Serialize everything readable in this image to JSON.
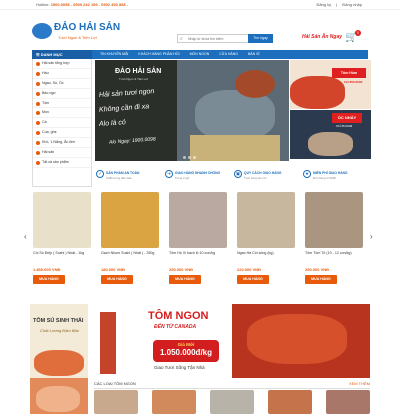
{
  "topbar": {
    "hotline_label": "Hotline:",
    "hotline_numbers": "1900.0098 - 0909 242 199 - 0902 450 868 -",
    "register": "Đăng ký",
    "divider": "|",
    "login": "Đăng nhập"
  },
  "header": {
    "logo_title": "ĐẢO HẢI SẢN",
    "logo_sub": "Tươi Ngon & Tiện Lợi",
    "search_placeholder": "Nhập từ khóa tìm kiếm",
    "search_button": "Tìm ngay",
    "slogan": "Hải Sản Ăn Ngay",
    "cart_count": "0"
  },
  "nav": {
    "category_label": "DANH MỤC",
    "links": [
      "TIN KHUYẾN MÃI",
      "KHÁCH HÀNG PHẢN HỒI",
      "MÓN NGON",
      "CỬA HÀNG",
      "BÁN SỈ"
    ]
  },
  "sidebar": {
    "items": [
      "Hải sản tổng hợp",
      "Hàu",
      "Ngao, Sò, Ốc",
      "Bào ngư",
      "Tôm",
      "Mực",
      "Cá",
      "Cua, ghẹ",
      "Khô, 1 Nắng, Ăn liền",
      "Hải sản",
      "Tất cả sản phẩm"
    ]
  },
  "banner": {
    "logo": "ĐẢO HẢI SẢN",
    "logo_sub": "Tươi Ngon & Tiện Lợi",
    "line1": "Hải sản tươi ngon",
    "line2": "Không cần đi xa",
    "line3": "Alo là có",
    "hotline": "Alo Ngay: 1900.0098"
  },
  "side_ads": {
    "ad1_tag": "Tôm Hùm",
    "ad1_price": "Chỉ 850.000đ",
    "ad2_tag": "ỐC NHẢY",
    "ad2_price": "Chỉ 45.000đ"
  },
  "features": [
    {
      "title": "SẢN PHẨM AN TOÀN",
      "sub": "Chất lượng đảm bảo"
    },
    {
      "title": "GIAO HÀNG NHANH CHÓNG",
      "sub": "Trong 2 giờ"
    },
    {
      "title": "QUY CÁCH GIAO HÀNG",
      "sub": "Tươi sống tận nơi"
    },
    {
      "title": "MIỄN PHÍ GIAO HÀNG",
      "sub": "Đơn hàng từ 500K"
    }
  ],
  "products": [
    {
      "name": "Cồi Sò Điệp ( Sushi ) Nhật - 1kg",
      "price": "1.850.000 VNĐ",
      "button": "MUA HÀNG"
    },
    {
      "name": "Gạch Nhum Sushi ( Nhật ) - 250g",
      "price": "180.000 VNĐ",
      "button": "MUA HÀNG"
    },
    {
      "name": "Tôm Hộ Xi bạch lô 10 con/kg",
      "price": "290.000 VNĐ",
      "button": "MUA HÀNG"
    },
    {
      "name": "Ngao Hà Cồi sống (kg)",
      "price": "220.000 VNĐ",
      "button": "MUA HÀNG"
    },
    {
      "name": "Tôm Tôm Tít (10 - 12 con/kg)",
      "price": "290.000 VNĐ",
      "button": "MUA HÀNG"
    }
  ],
  "promo": {
    "left_title": "TÔM SÚ SINH THÁI",
    "left_sub": "Chất Lượng Đảm Bảo",
    "title": "TÔM NGON",
    "sub": "ĐẾN TỪ CANADA",
    "price_label": "Giá Mới",
    "price": "1.050.000đ/kg",
    "deliver": "Giao Tươi Sống Tận Nhà"
  },
  "section": {
    "title": "CÁC LOẠI TÔM NGON",
    "more": "XEM THÊM"
  },
  "colors": {
    "primary": "#1d6fbd",
    "accent": "#e85b0c",
    "red": "#d21e1e"
  }
}
